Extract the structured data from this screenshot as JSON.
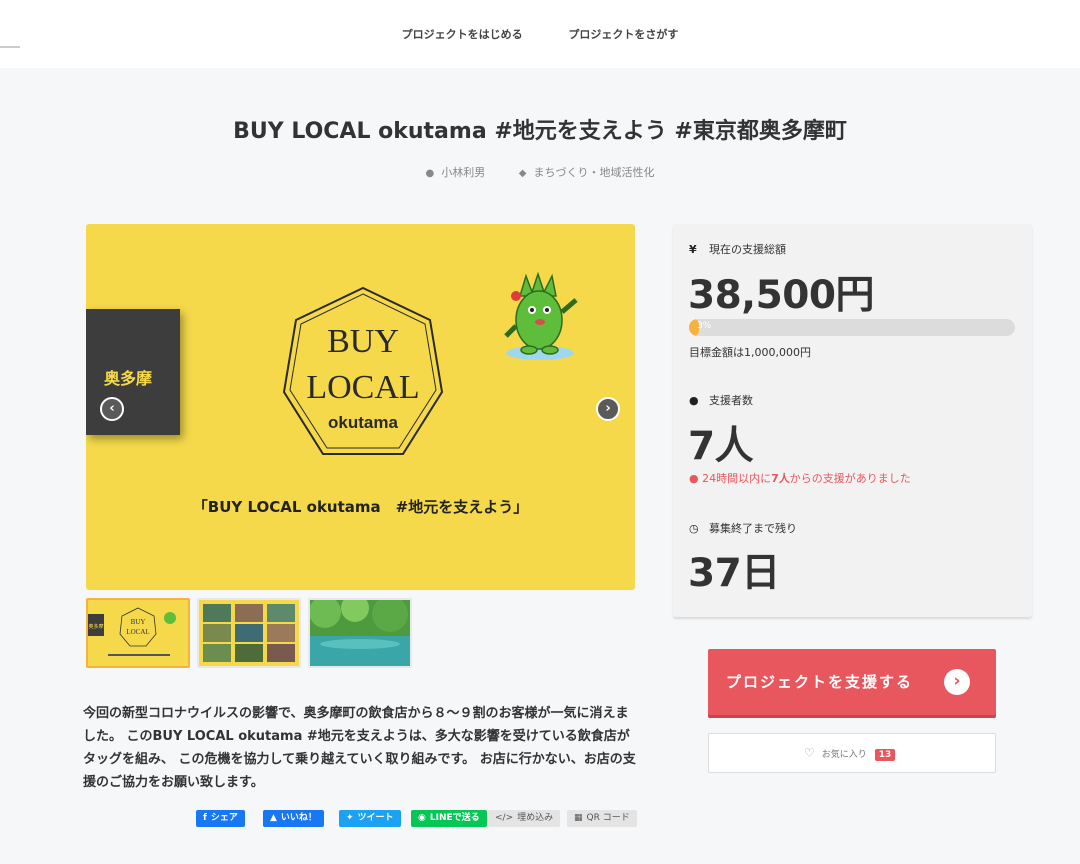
{
  "nav": {
    "start_label": "プロジェクトをはじめる",
    "search_label": "プロジェクトをさがす"
  },
  "project": {
    "title": "BUY LOCAL okutama #地元を支えよう #東京都奥多摩町",
    "author": "小林利男",
    "category": "まちづくり・地域活性化"
  },
  "hero": {
    "side_label": "奥多摩",
    "logo_line1": "BUY",
    "logo_line2": "LOCAL",
    "logo_line3": "okutama",
    "caption": "「BUY LOCAL okutama　#地元を支えよう」",
    "thumb_label": "奥多摩"
  },
  "description": "今回の新型コロナウイルスの影響で、奥多摩町の飲食店から８〜９割のお客様が一気に消えました。 このBUY LOCAL okutama #地元を支えようは、多大な影響を受けている飲食店がタッグを組み、 この危機を協力して乗り越えていく取り組みです。 お店に行かない、お店の支援のご協力をお願い致します。",
  "share": {
    "facebook": "シェア",
    "like": "いいね！",
    "tweet": "ツイート",
    "line": "LINEで送る",
    "embed": "埋め込み",
    "qr": "QR コード"
  },
  "stats": {
    "amount_label": "現在の支援総額",
    "amount": "38,500円",
    "progress_percent": 3,
    "progress_text": "3%",
    "goal": "目標金額は1,000,000円",
    "backers_label": "支援者数",
    "backers": "7人",
    "recent_prefix": "24時間以内に",
    "recent_count": "7人",
    "recent_suffix": "からの支援がありました",
    "remaining_label": "募集終了まで残り",
    "remaining": "37日"
  },
  "actions": {
    "support_label": "プロジェクトを支援する",
    "favorite_label": "お気に入り",
    "favorite_count": "13"
  },
  "colors": {
    "accent": "#e8575e",
    "progress": "#f5b23c",
    "hero_bg": "#f5d94a"
  }
}
